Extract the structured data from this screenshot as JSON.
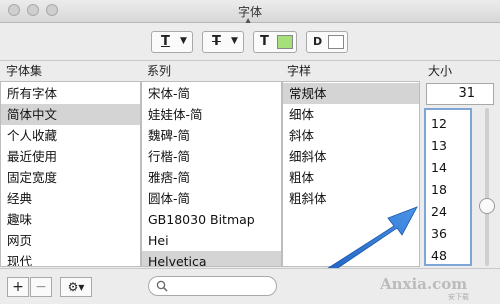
{
  "window": {
    "title": "字体"
  },
  "toolbar": {
    "underline_glyph": "T",
    "strike_glyph": "T",
    "text_color_glyph": "T",
    "doc_glyph": "D",
    "text_color": "#a6e07a",
    "doc_color": "#ffffff"
  },
  "columns": {
    "collections": "字体集",
    "family": "系列",
    "typeface": "字样",
    "size": "大小"
  },
  "collections": [
    {
      "label": "所有字体",
      "selected": false
    },
    {
      "label": "简体中文",
      "selected": true
    },
    {
      "label": "个人收藏",
      "selected": false
    },
    {
      "label": "最近使用",
      "selected": false
    },
    {
      "label": "固定宽度",
      "selected": false
    },
    {
      "label": "经典",
      "selected": false
    },
    {
      "label": "趣味",
      "selected": false
    },
    {
      "label": "网页",
      "selected": false
    },
    {
      "label": "现代",
      "selected": false
    }
  ],
  "families": [
    {
      "label": "宋体-简",
      "selected": false
    },
    {
      "label": "娃娃体-简",
      "selected": false
    },
    {
      "label": "魏碑-简",
      "selected": false
    },
    {
      "label": "行楷-简",
      "selected": false
    },
    {
      "label": "雅痞-简",
      "selected": false
    },
    {
      "label": "圆体-简",
      "selected": false
    },
    {
      "label": "GB18030 Bitmap",
      "selected": false
    },
    {
      "label": "Hei",
      "selected": false
    },
    {
      "label": "Helvetica",
      "selected": true
    }
  ],
  "typefaces": [
    {
      "label": "常规体",
      "selected": true
    },
    {
      "label": "细体",
      "selected": false
    },
    {
      "label": "斜体",
      "selected": false
    },
    {
      "label": "细斜体",
      "selected": false
    },
    {
      "label": "粗体",
      "selected": false
    },
    {
      "label": "粗斜体",
      "selected": false
    }
  ],
  "size": {
    "value": "31",
    "options": [
      "12",
      "13",
      "14",
      "18",
      "24",
      "36",
      "48"
    ]
  },
  "bottom": {
    "add": "+",
    "remove": "−",
    "gear": "⚙▾"
  },
  "watermark": {
    "text": "Anxia.com",
    "sub": "安下载"
  }
}
